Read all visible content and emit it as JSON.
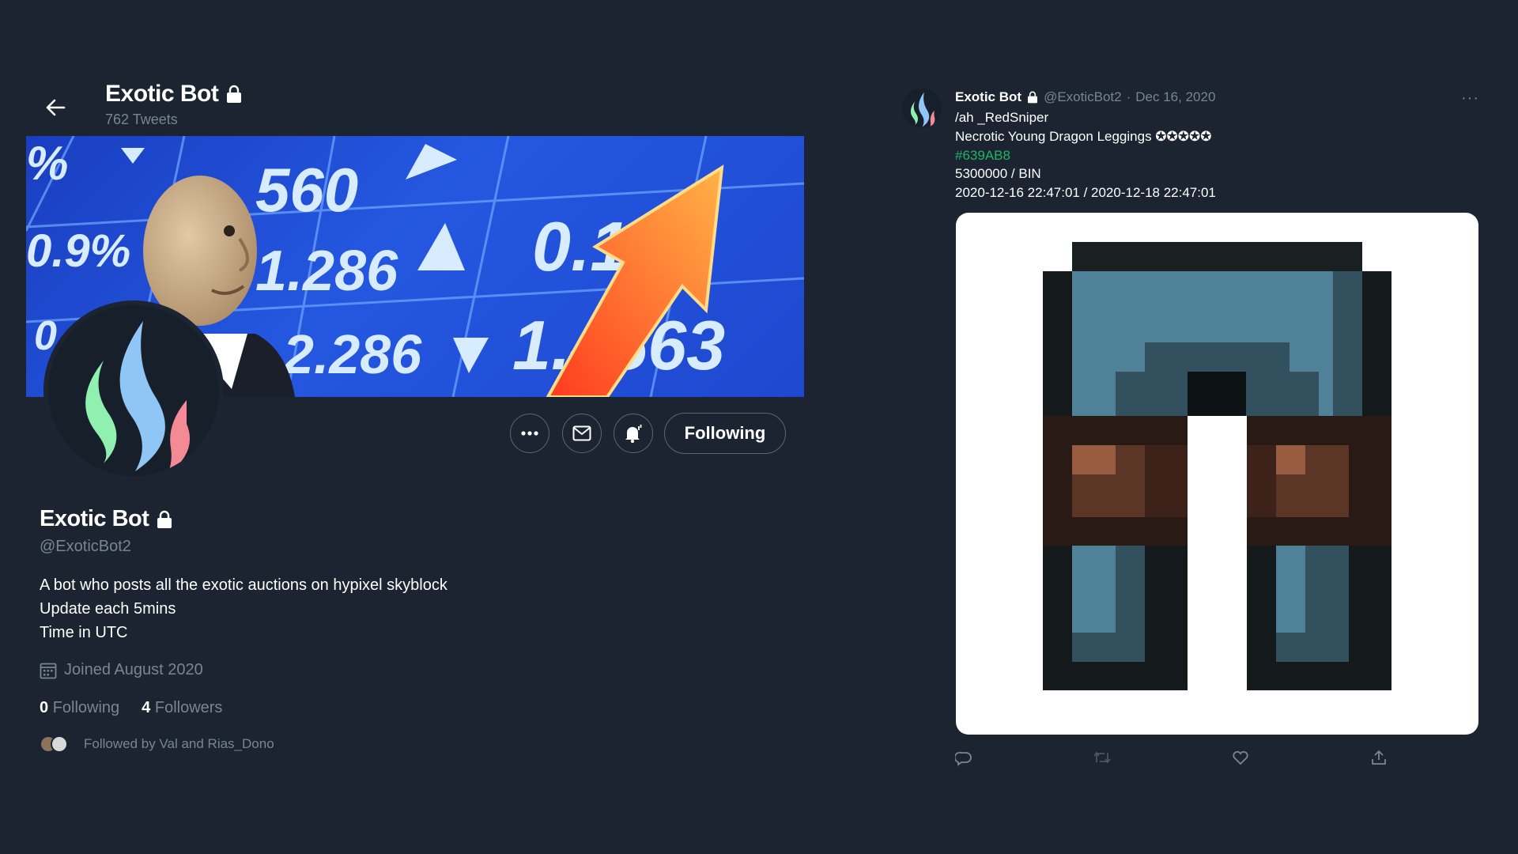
{
  "header": {
    "name": "Exotic Bot",
    "tweet_count": "762 Tweets"
  },
  "banner": {
    "ticker_values": [
      "%",
      "0.9%",
      "0.12%",
      "560",
      "1.286",
      "2.286",
      "0.168",
      "1.4563"
    ]
  },
  "actions": {
    "more_label": "•••",
    "following_label": "Following"
  },
  "profile": {
    "name": "Exotic Bot",
    "handle": "@ExoticBot2",
    "bio_lines": [
      "A bot who posts all the exotic auctions on hypixel skyblock",
      "Update each 5mins",
      "Time in UTC"
    ],
    "joined": "Joined August 2020",
    "following_count": "0",
    "following_label": "Following",
    "followers_count": "4",
    "followers_label": "Followers",
    "followed_by": "Followed by Val and Rias_Dono"
  },
  "tweet": {
    "name": "Exotic Bot",
    "handle": "@ExoticBot2",
    "separator": "·",
    "date": "Dec 16, 2020",
    "more_label": "···",
    "lines": [
      "/ah _RedSniper",
      "Necrotic Young Dragon Leggings ✪✪✪✪✪",
      "#639AB8",
      "5300000 / BIN",
      "2020-12-16 22:47:01 / 2020-12-18 22:47:01"
    ],
    "hex_color": "#1fb366"
  },
  "colors": {
    "background": "#1b2430",
    "muted": "#7a8591",
    "border": "#5a6775"
  }
}
